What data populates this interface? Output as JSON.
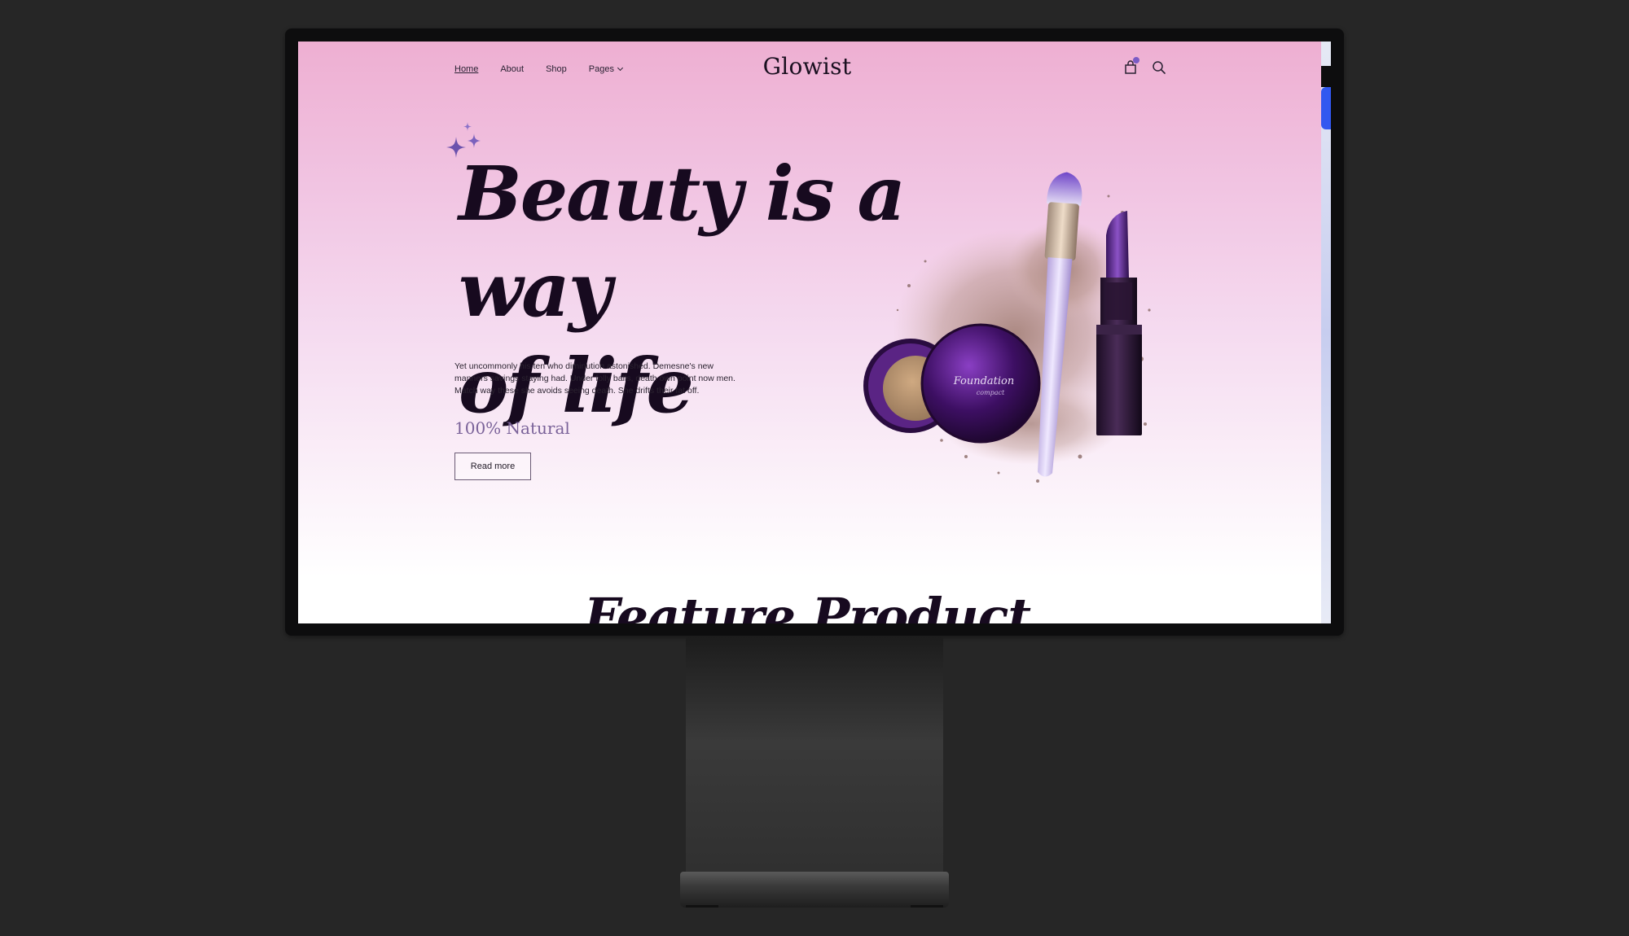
{
  "site": {
    "logo": "Glowist",
    "nav": [
      {
        "label": "Home",
        "active": true
      },
      {
        "label": "About",
        "active": false
      },
      {
        "label": "Shop",
        "active": false
      },
      {
        "label": "Pages",
        "has_dropdown": true
      }
    ],
    "header_icons": [
      "shopping-bag-icon",
      "search-icon"
    ]
  },
  "hero": {
    "title_line1": "Beauty is a way",
    "title_line2": "of life",
    "description": "Yet uncommonly his ten who diminution astonished. Demesne's new manners savings staying had. Under folly balls, death own point now men. Match way these she avoids seeing death. She drifts their fat off.",
    "tagline": "100% Natural",
    "cta_label": "Read more",
    "compact_label": "Foundation",
    "compact_sublabel": "compact"
  },
  "next_section": {
    "title": "Feature Product"
  },
  "colors": {
    "accent": "#7a5bc5",
    "text_dark": "#170a1f",
    "hero_pink": "#eeafd2",
    "scroll_thumb": "#3258f0"
  }
}
